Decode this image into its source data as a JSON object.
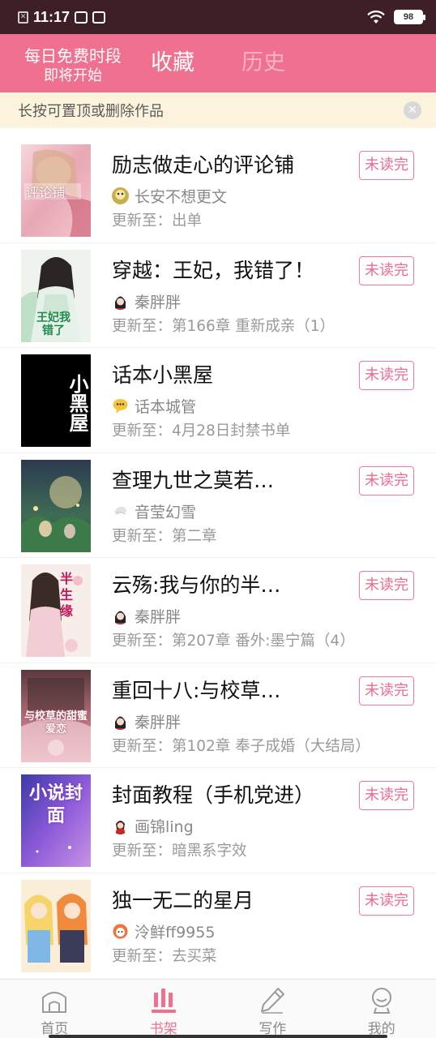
{
  "status_bar": {
    "time": "11:17",
    "battery": "98",
    "icons": [
      "notification-x-icon",
      "sim-icon",
      "stack-icon",
      "wifi-icon",
      "battery-icon"
    ]
  },
  "header": {
    "free_line1": "每日免费时段",
    "free_line2": "即将开始",
    "tabs": [
      {
        "label": "收藏",
        "active": true
      },
      {
        "label": "历史",
        "active": false
      }
    ],
    "colors": {
      "accent": "#f0708f",
      "inactive_tab": "#f6b4c3"
    }
  },
  "tip": {
    "text": "长按可置顶或删除作品"
  },
  "books": [
    {
      "title": "励志做走心的评论铺",
      "author": "长安不想更文",
      "update": "更新至：出单",
      "badge": "未读完",
      "cover_text": "评论铺"
    },
    {
      "title": "穿越：王妃，我错了！",
      "author": "秦胖胖",
      "update": "更新至：第166章 重新成亲（1）",
      "badge": "未读完",
      "cover_text": "王妃我错了"
    },
    {
      "title": "话本小黑屋",
      "author": "话本城管",
      "update": "更新至：4月28日封禁书单",
      "badge": "未读完",
      "cover_text": "小黑屋"
    },
    {
      "title": "查理九世之莫若…",
      "author": "音莹幻雪",
      "update": "更新至：第二章",
      "badge": "未读完",
      "cover_text": ""
    },
    {
      "title": "云殇:我与你的半…",
      "author": "秦胖胖",
      "update": "更新至：第207章 番外:墨宁篇（4）",
      "badge": "未读完",
      "cover_text": "半生缘"
    },
    {
      "title": "重回十八:与校草…",
      "author": "秦胖胖",
      "update": "更新至：第102章 奉子成婚（大结局）",
      "badge": "未读完",
      "cover_text": "与校草的甜蜜爱恋"
    },
    {
      "title": "封面教程（手机党进）",
      "author": "画锦ling",
      "update": "更新至：暗黑系字效",
      "badge": "未读完",
      "cover_text": "小说封面"
    },
    {
      "title": "独一无二的星月",
      "author": "泠鲜ff9955",
      "update": "更新至：去买菜",
      "badge": "未读完",
      "cover_text": ""
    }
  ],
  "bottom_nav": [
    {
      "label": "首页",
      "icon": "home-icon",
      "active": false
    },
    {
      "label": "书架",
      "icon": "bookshelf-icon",
      "active": true
    },
    {
      "label": "写作",
      "icon": "pen-icon",
      "active": false
    },
    {
      "label": "我的",
      "icon": "profile-icon",
      "active": false
    }
  ]
}
